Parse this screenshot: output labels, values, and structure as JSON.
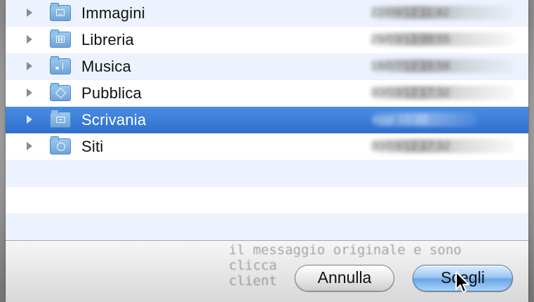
{
  "files": [
    {
      "name": "Immagini",
      "date": "22/09/12 11:42",
      "icon": "folder-pictures-icon",
      "selected": false
    },
    {
      "name": "Libreria",
      "date": "29/03/13 09:55",
      "icon": "folder-library-icon",
      "selected": false
    },
    {
      "name": "Musica",
      "date": "18/07/12 15:58",
      "icon": "folder-music-icon",
      "selected": false
    },
    {
      "name": "Pubblica",
      "date": "30/03/12 17:32",
      "icon": "folder-public-icon",
      "selected": false
    },
    {
      "name": "Scrivania",
      "date": "oggi 15:32",
      "icon": "folder-desktop-icon",
      "selected": true
    },
    {
      "name": "Siti",
      "date": "30/03/12 17:32",
      "icon": "folder-sites-icon",
      "selected": false
    }
  ],
  "background_text": "il messaggio originale e sono\nclicca\nclient",
  "buttons": {
    "cancel": "Annulla",
    "choose": "Scegli"
  },
  "colors": {
    "selection": "#3476d6",
    "alternate_row": "#edf3fe",
    "primary_button": "#8cc3f5"
  }
}
